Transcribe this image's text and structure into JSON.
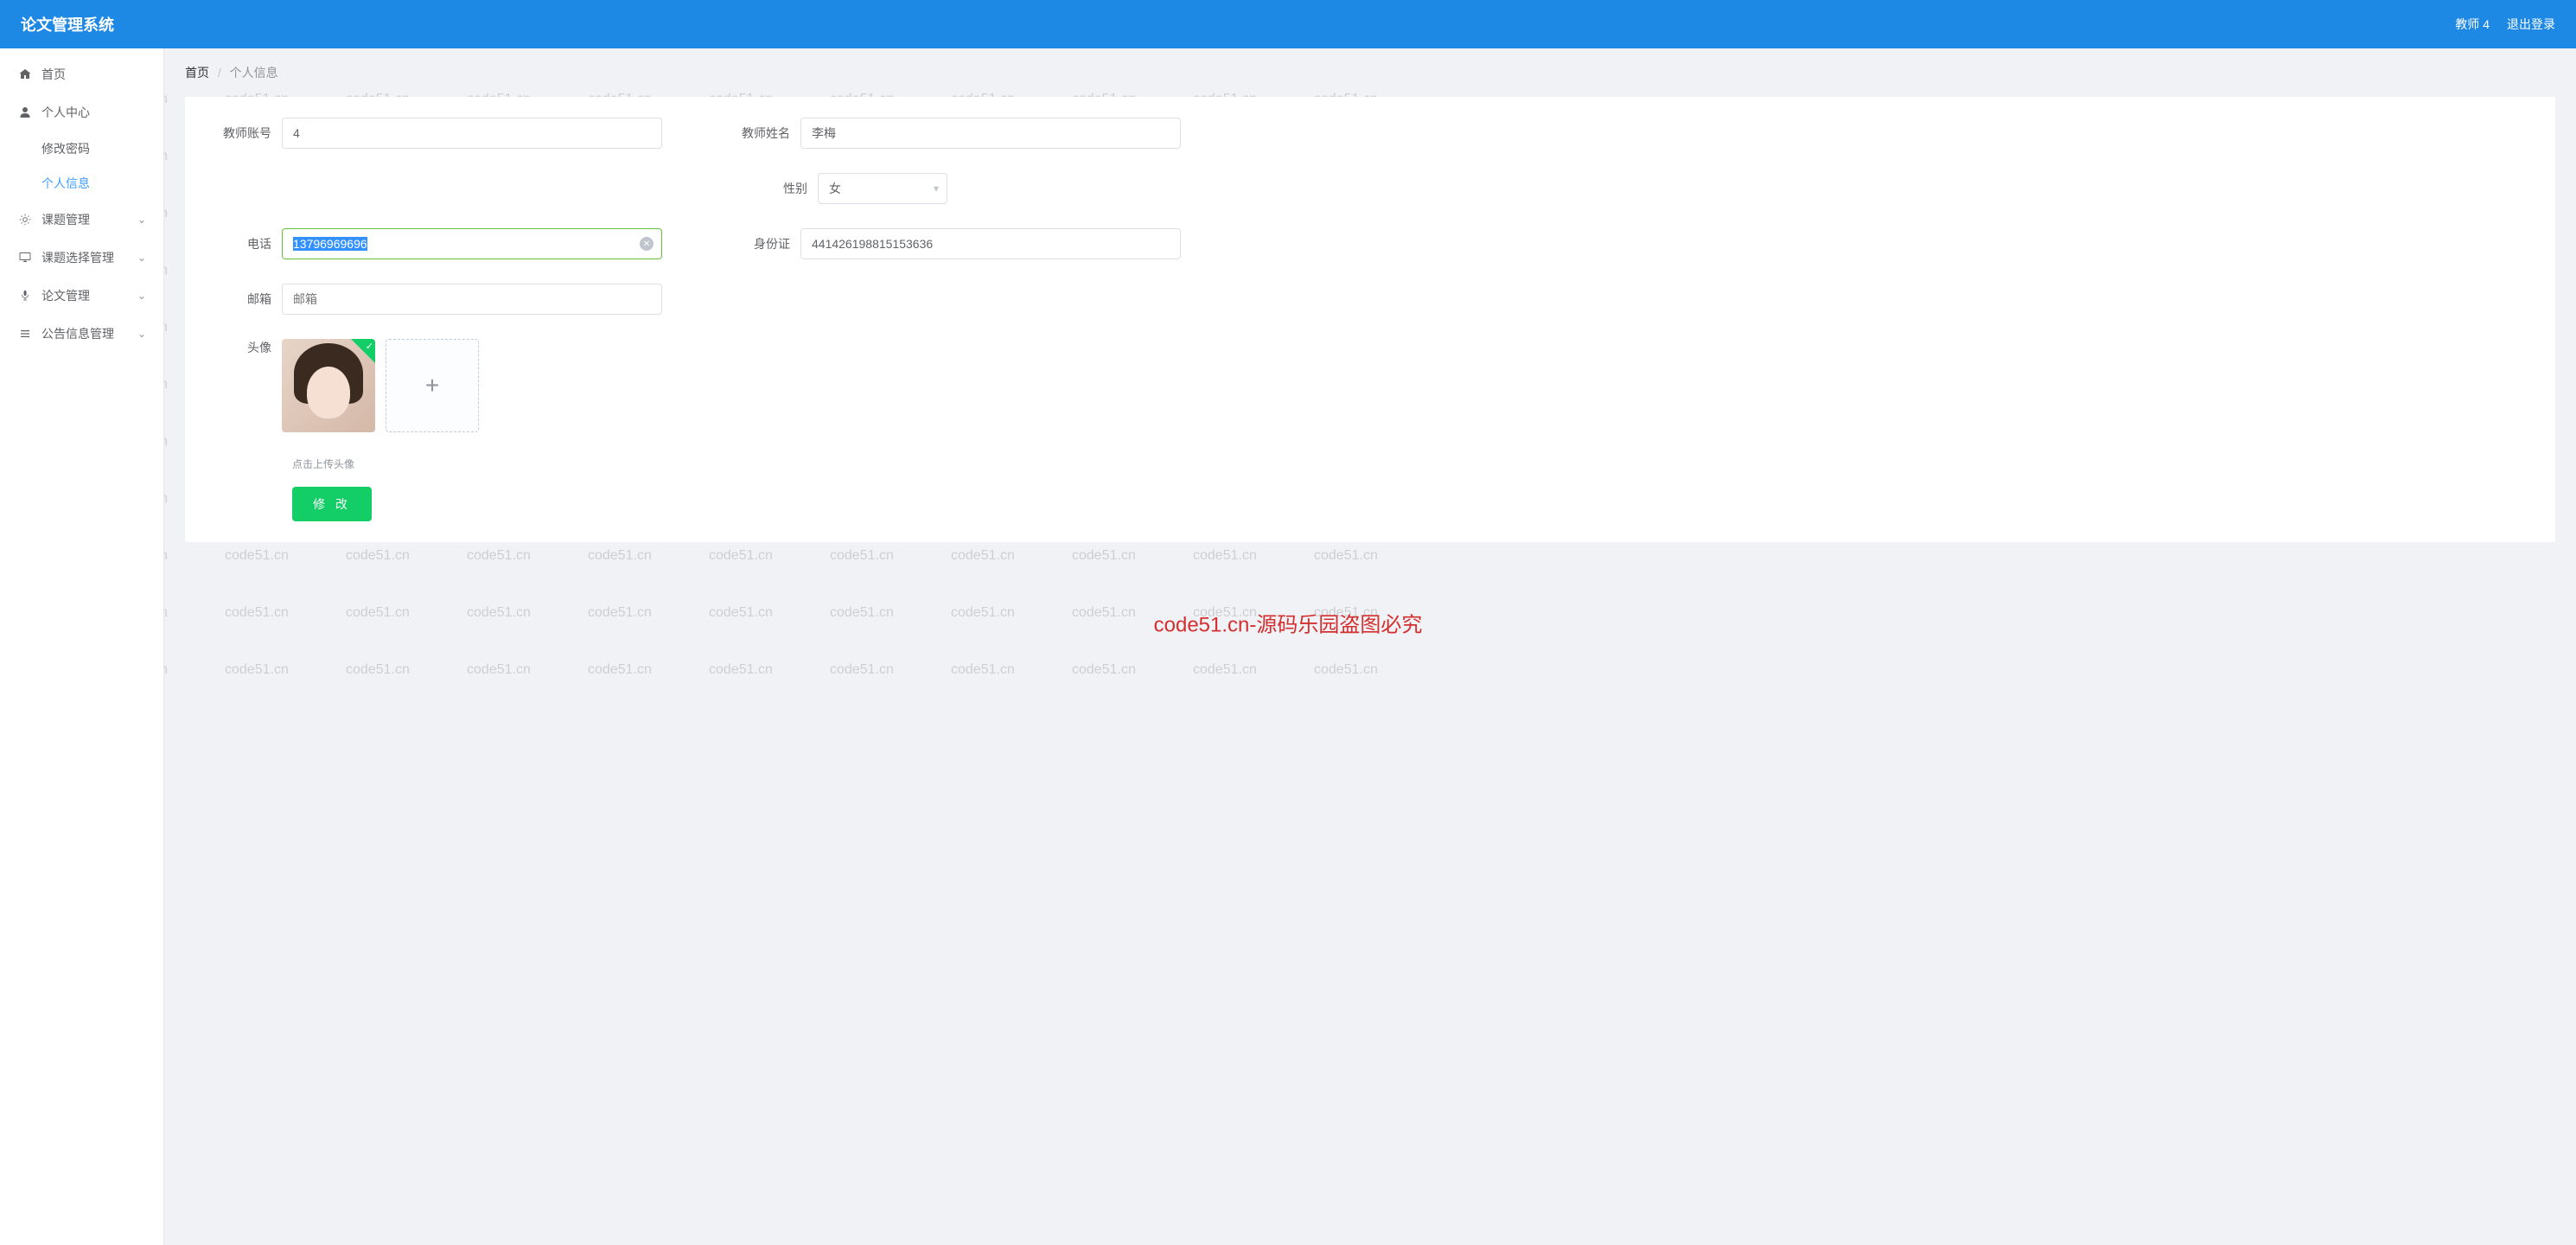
{
  "header": {
    "title": "论文管理系统",
    "user": "教师 4",
    "logout": "退出登录"
  },
  "sidebar": {
    "home": "首页",
    "personal_center": "个人中心",
    "change_password": "修改密码",
    "personal_info": "个人信息",
    "topic_mgmt": "课题管理",
    "topic_select_mgmt": "课题选择管理",
    "thesis_mgmt": "论文管理",
    "notice_mgmt": "公告信息管理"
  },
  "breadcrumb": {
    "home": "首页",
    "current": "个人信息"
  },
  "form": {
    "teacher_account_label": "教师账号",
    "teacher_account_value": "4",
    "teacher_name_label": "教师姓名",
    "teacher_name_value": "李梅",
    "gender_label": "性别",
    "gender_value": "女",
    "phone_label": "电话",
    "phone_value": "13796969696",
    "idcard_label": "身份证",
    "idcard_value": "441426198815153636",
    "email_label": "邮箱",
    "email_placeholder": "邮箱",
    "avatar_label": "头像",
    "upload_hint": "点击上传头像",
    "submit": "修 改"
  },
  "watermark": {
    "repeat_text": "code51.cn",
    "center_text": "code51.cn-源码乐园盗图必究"
  }
}
